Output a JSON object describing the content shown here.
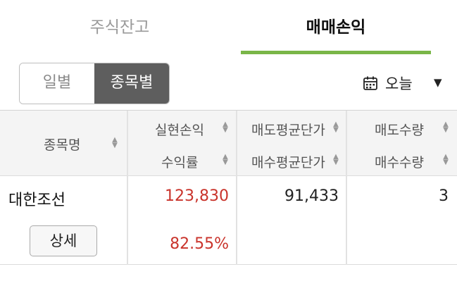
{
  "tabs": [
    {
      "label": "주식잔고"
    },
    {
      "label": "매매손익"
    }
  ],
  "segment": {
    "daily": "일별",
    "by_stock": "종목별"
  },
  "date_filter": {
    "label": "오늘",
    "icon": "calendar-icon"
  },
  "table": {
    "headers": {
      "name": "종목명",
      "profit": "실현손익",
      "return_rate": "수익률",
      "sell_avg": "매도평균단가",
      "buy_avg": "매수평균단가",
      "sell_qty": "매도수량",
      "buy_qty": "매수수량"
    },
    "rows": [
      {
        "name": "대한조선",
        "profit": "123,830",
        "return_rate": "82.55%",
        "sell_avg": "91,433",
        "buy_avg": "",
        "sell_qty": "3",
        "buy_qty": "",
        "detail_label": "상세"
      }
    ]
  },
  "colors": {
    "accent": "#7ab648",
    "positive": "#c9332b",
    "segment_active": "#5e5e5e"
  }
}
